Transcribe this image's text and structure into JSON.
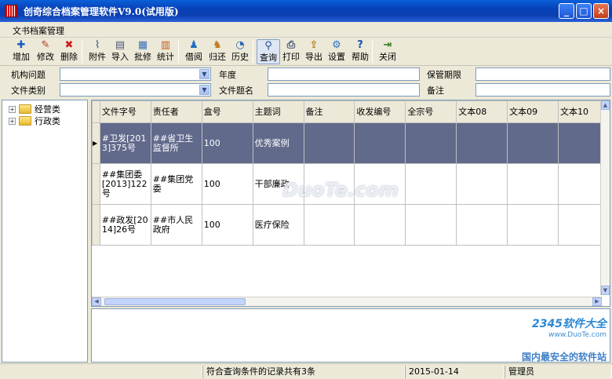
{
  "window": {
    "title": "创奇综合档案管理软件V9.0(试用版)",
    "buttons": [
      "_",
      "□",
      "×"
    ]
  },
  "menu": {
    "items": [
      "文书档案管理"
    ]
  },
  "toolbar": {
    "buttons": [
      {
        "label": "增加",
        "icon": "add-icon",
        "glyph": "✚",
        "color": "#1b56c8"
      },
      {
        "label": "修改",
        "icon": "edit-icon",
        "glyph": "✎",
        "color": "#b23b1e"
      },
      {
        "label": "删除",
        "icon": "delete-icon",
        "glyph": "✖",
        "color": "#d21c1c"
      },
      {
        "label": "附件",
        "icon": "attachment-icon",
        "glyph": "⌇",
        "color": "#4e6fa3"
      },
      {
        "label": "导入",
        "icon": "import-icon",
        "glyph": "▤",
        "color": "#4a5a78"
      },
      {
        "label": "批修",
        "icon": "batch-edit-icon",
        "glyph": "▦",
        "color": "#3c6fb4"
      },
      {
        "label": "统计",
        "icon": "statistics-icon",
        "glyph": "▥",
        "color": "#c25a18"
      },
      {
        "label": "借阅",
        "icon": "borrow-icon",
        "glyph": "♟",
        "color": "#1f6fc0"
      },
      {
        "label": "归还",
        "icon": "return-icon",
        "glyph": "♞",
        "color": "#c07818"
      },
      {
        "label": "历史",
        "icon": "history-icon",
        "glyph": "◔",
        "color": "#2466b8"
      },
      {
        "label": "查询",
        "icon": "search-icon",
        "glyph": "⚲",
        "color": "#2a4f8f"
      },
      {
        "label": "打印",
        "icon": "print-icon",
        "glyph": "⎙",
        "color": "#3e5273"
      },
      {
        "label": "导出",
        "icon": "export-icon",
        "glyph": "⇪",
        "color": "#b07a18"
      },
      {
        "label": "设置",
        "icon": "settings-icon",
        "glyph": "⚙",
        "color": "#2f6fc4"
      },
      {
        "label": "帮助",
        "icon": "help-icon",
        "glyph": "?",
        "color": "#1a4fb0"
      },
      {
        "label": "关闭",
        "icon": "close-icon",
        "glyph": "⇥",
        "color": "#3a7d2a"
      }
    ]
  },
  "filters": {
    "org_label": "机构问题",
    "year_label": "年度",
    "retention_label": "保管期限",
    "category_label": "文件类别",
    "title_label": "文件题名",
    "note_label": "备注"
  },
  "tree": {
    "nodes": [
      "经营类",
      "行政类"
    ]
  },
  "grid": {
    "columns": [
      "文件字号",
      "责任者",
      "盒号",
      "主题词",
      "备注",
      "收发编号",
      "全宗号",
      "文本08",
      "文本09",
      "文本10"
    ],
    "rows": [
      [
        "#卫发[2013]375号",
        "##省卫生监督所",
        "100",
        "优秀案例",
        "",
        "",
        "",
        "",
        "",
        ""
      ],
      [
        "##集团委[2013]122号",
        "##集团党委",
        "100",
        "干部廉政",
        "",
        "",
        "",
        "",
        "",
        ""
      ],
      [
        "##政发[2014]26号",
        "##市人民政府",
        "100",
        "医疗保险",
        "",
        "",
        "",
        "",
        "",
        ""
      ]
    ],
    "selected_row": 0
  },
  "watermark": {
    "line1": "DuoTe.com",
    "brand": "2345软件大全",
    "url": "www.DuoTe.com",
    "slogan": "国内最安全的软件站"
  },
  "status": {
    "message": "符合查询条件的记录共有3条",
    "date": "2015-01-14",
    "user": "管理员"
  }
}
